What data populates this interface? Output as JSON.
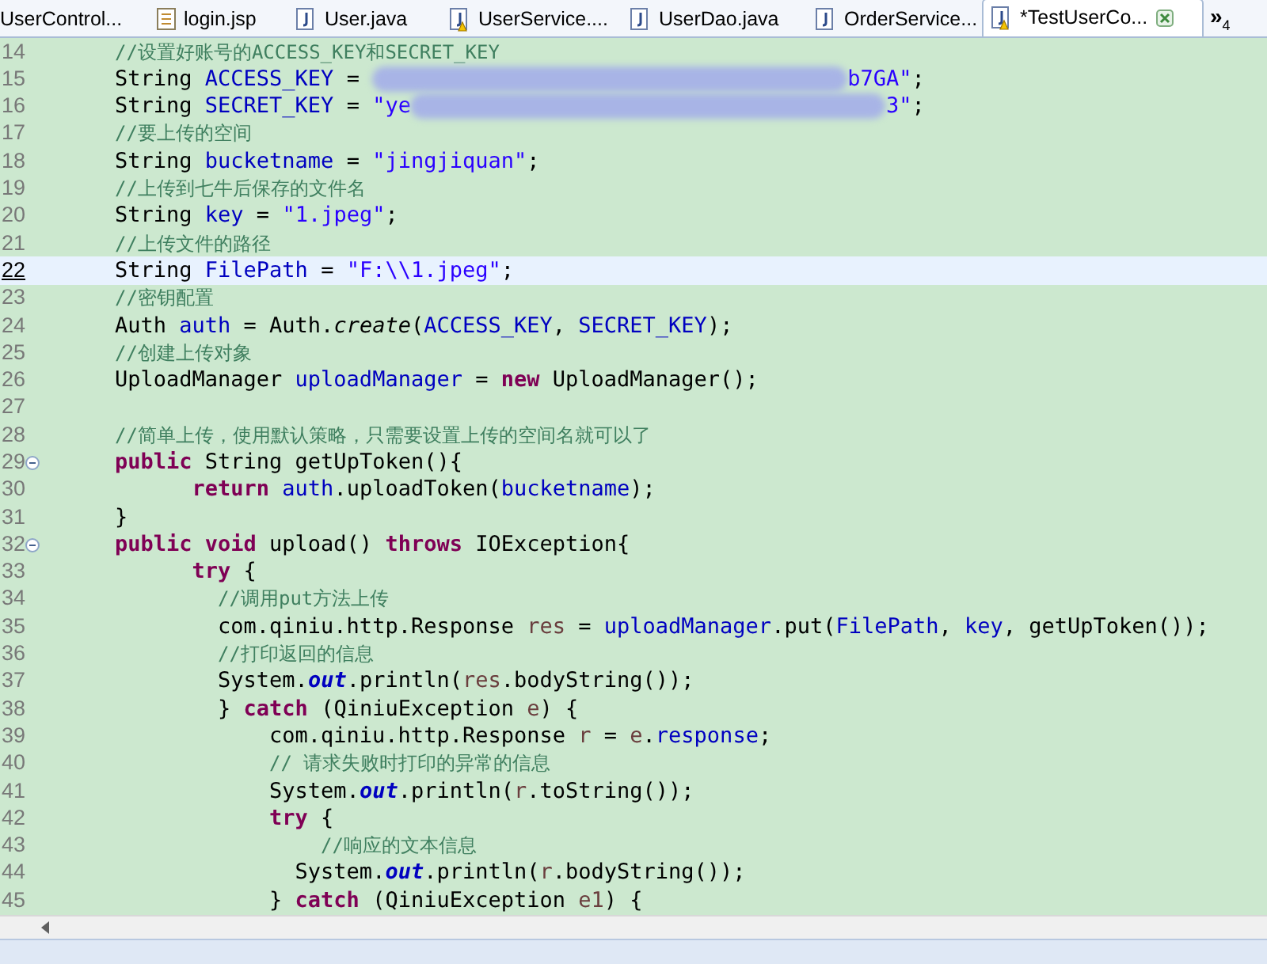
{
  "tabs": [
    {
      "label": "UserControl...",
      "kind": "plain",
      "selected": false
    },
    {
      "label": "login.jsp",
      "kind": "page",
      "selected": false
    },
    {
      "label": "User.java",
      "kind": "java",
      "selected": false
    },
    {
      "label": "UserService....",
      "kind": "java_warning",
      "selected": false
    },
    {
      "label": "UserDao.java",
      "kind": "java",
      "selected": false
    },
    {
      "label": "OrderService...",
      "kind": "java",
      "selected": false
    },
    {
      "label": "*TestUserCo...",
      "kind": "java_warning",
      "selected": true
    }
  ],
  "overflow": {
    "symbol": "»",
    "count": "4"
  },
  "editor": {
    "lines": [
      {
        "number": "14",
        "current": false,
        "fold": false,
        "tokens": [
          {
            "kind": "comment",
            "text": "//设置好账号的ACCESS_KEY和SECRET_KEY"
          }
        ]
      },
      {
        "number": "15",
        "current": false,
        "fold": false,
        "tokens": [
          {
            "kind": "plain",
            "text": "String "
          },
          {
            "kind": "field",
            "text": "ACCESS_KEY"
          },
          {
            "kind": "plain",
            "text": " = "
          },
          {
            "kind": "redacted"
          },
          {
            "kind": "string",
            "text": "b7GA\""
          },
          {
            "kind": "plain",
            "text": ";"
          }
        ]
      },
      {
        "number": "16",
        "current": false,
        "fold": false,
        "tokens": [
          {
            "kind": "plain",
            "text": "String "
          },
          {
            "kind": "field",
            "text": "SECRET_KEY"
          },
          {
            "kind": "plain",
            "text": " = "
          },
          {
            "kind": "string",
            "text": "\"ye"
          },
          {
            "kind": "redacted"
          },
          {
            "kind": "string",
            "text": "3\""
          },
          {
            "kind": "plain",
            "text": ";"
          }
        ]
      },
      {
        "number": "17",
        "current": false,
        "fold": false,
        "tokens": [
          {
            "kind": "comment",
            "text": "//要上传的空间"
          }
        ]
      },
      {
        "number": "18",
        "current": false,
        "fold": false,
        "tokens": [
          {
            "kind": "plain",
            "text": "String "
          },
          {
            "kind": "field",
            "text": "bucketname"
          },
          {
            "kind": "plain",
            "text": " = "
          },
          {
            "kind": "string",
            "text": "\"jingjiquan\""
          },
          {
            "kind": "plain",
            "text": ";"
          }
        ]
      },
      {
        "number": "19",
        "current": false,
        "fold": false,
        "tokens": [
          {
            "kind": "comment",
            "text": "//上传到七牛后保存的文件名"
          }
        ]
      },
      {
        "number": "20",
        "current": false,
        "fold": false,
        "tokens": [
          {
            "kind": "plain",
            "text": "String "
          },
          {
            "kind": "field",
            "text": "key"
          },
          {
            "kind": "plain",
            "text": " = "
          },
          {
            "kind": "string",
            "text": "\"1.jpeg\""
          },
          {
            "kind": "plain",
            "text": ";"
          }
        ]
      },
      {
        "number": "21",
        "current": false,
        "fold": false,
        "tokens": [
          {
            "kind": "comment",
            "text": "//上传文件的路径"
          }
        ]
      },
      {
        "number": "22",
        "current": true,
        "fold": false,
        "tokens": [
          {
            "kind": "plain",
            "text": "String "
          },
          {
            "kind": "field",
            "text": "FilePath"
          },
          {
            "kind": "plain",
            "text": " = "
          },
          {
            "kind": "string",
            "text": "\"F:\\\\1.jpeg\""
          },
          {
            "kind": "plain",
            "text": ";"
          }
        ]
      },
      {
        "number": "23",
        "current": false,
        "fold": false,
        "tokens": [
          {
            "kind": "comment",
            "text": "//密钥配置"
          }
        ]
      },
      {
        "number": "24",
        "current": false,
        "fold": false,
        "tokens": [
          {
            "kind": "plain",
            "text": "Auth "
          },
          {
            "kind": "field",
            "text": "auth"
          },
          {
            "kind": "plain",
            "text": " = Auth."
          },
          {
            "kind": "italic",
            "text": "create"
          },
          {
            "kind": "plain",
            "text": "("
          },
          {
            "kind": "field",
            "text": "ACCESS_KEY"
          },
          {
            "kind": "plain",
            "text": ", "
          },
          {
            "kind": "field",
            "text": "SECRET_KEY"
          },
          {
            "kind": "plain",
            "text": ");"
          }
        ]
      },
      {
        "number": "25",
        "current": false,
        "fold": false,
        "tokens": [
          {
            "kind": "comment",
            "text": "//创建上传对象"
          }
        ]
      },
      {
        "number": "26",
        "current": false,
        "fold": false,
        "tokens": [
          {
            "kind": "plain",
            "text": "UploadManager "
          },
          {
            "kind": "field",
            "text": "uploadManager"
          },
          {
            "kind": "plain",
            "text": " = "
          },
          {
            "kind": "keyword",
            "text": "new"
          },
          {
            "kind": "plain",
            "text": " UploadManager();"
          }
        ]
      },
      {
        "number": "27",
        "current": false,
        "fold": false
      },
      {
        "number": "28",
        "current": false,
        "fold": false,
        "tokens": [
          {
            "kind": "comment",
            "text": "//简单上传，使用默认策略，只需要设置上传的空间名就可以了"
          }
        ]
      },
      {
        "number": "29",
        "current": false,
        "fold": true,
        "tokens": [
          {
            "kind": "keyword",
            "text": "public"
          },
          {
            "kind": "plain",
            "text": " String getUpToken(){"
          }
        ]
      },
      {
        "number": "30",
        "current": false,
        "fold": false,
        "tokens": [
          {
            "kind": "keyword",
            "text": "return "
          },
          {
            "kind": "field",
            "text": "auth"
          },
          {
            "kind": "plain",
            "text": ".uploadToken("
          },
          {
            "kind": "field",
            "text": "bucketname"
          },
          {
            "kind": "plain",
            "text": ");"
          }
        ]
      },
      {
        "number": "31",
        "current": false,
        "fold": false,
        "tokens": [
          {
            "kind": "plain",
            "text": "}"
          }
        ]
      },
      {
        "number": "32",
        "current": false,
        "fold": true,
        "tokens": [
          {
            "kind": "keyword",
            "text": "public void"
          },
          {
            "kind": "plain",
            "text": " upload() "
          },
          {
            "kind": "keyword",
            "text": "throws"
          },
          {
            "kind": "plain",
            "text": " IOException{"
          }
        ]
      },
      {
        "number": "33",
        "current": false,
        "fold": false,
        "tokens": [
          {
            "kind": "keyword",
            "text": "try"
          },
          {
            "kind": "plain",
            "text": " {"
          }
        ]
      },
      {
        "number": "34",
        "current": false,
        "fold": false,
        "tokens": [
          {
            "kind": "comment",
            "text": "//调用put方法上传"
          }
        ]
      },
      {
        "number": "35",
        "current": false,
        "fold": false,
        "tokens": [
          {
            "kind": "plain",
            "text": "com.qiniu.http.Response "
          },
          {
            "kind": "local",
            "text": "res"
          },
          {
            "kind": "plain",
            "text": " = "
          },
          {
            "kind": "field",
            "text": "uploadManager"
          },
          {
            "kind": "plain",
            "text": ".put("
          },
          {
            "kind": "field",
            "text": "FilePath"
          },
          {
            "kind": "plain",
            "text": ", "
          },
          {
            "kind": "field",
            "text": "key"
          },
          {
            "kind": "plain",
            "text": ", getUpToken());"
          }
        ]
      },
      {
        "number": "36",
        "current": false,
        "fold": false,
        "tokens": [
          {
            "kind": "comment",
            "text": "//打印返回的信息"
          }
        ]
      },
      {
        "number": "37",
        "current": false,
        "fold": false,
        "tokens": [
          {
            "kind": "plain",
            "text": "System."
          },
          {
            "kind": "static",
            "text": "out"
          },
          {
            "kind": "plain",
            "text": ".println("
          },
          {
            "kind": "local",
            "text": "res"
          },
          {
            "kind": "plain",
            "text": ".bodyString());"
          }
        ]
      },
      {
        "number": "38",
        "current": false,
        "fold": false,
        "tokens": [
          {
            "kind": "plain",
            "text": "} "
          },
          {
            "kind": "keyword",
            "text": "catch"
          },
          {
            "kind": "plain",
            "text": " (QiniuException "
          },
          {
            "kind": "local",
            "text": "e"
          },
          {
            "kind": "plain",
            "text": ") {"
          }
        ]
      },
      {
        "number": "39",
        "current": false,
        "fold": false,
        "tokens": [
          {
            "kind": "plain",
            "text": "com.qiniu.http.Response "
          },
          {
            "kind": "local",
            "text": "r"
          },
          {
            "kind": "plain",
            "text": " = "
          },
          {
            "kind": "local",
            "text": "e"
          },
          {
            "kind": "plain",
            "text": "."
          },
          {
            "kind": "field",
            "text": "response"
          },
          {
            "kind": "plain",
            "text": ";"
          }
        ]
      },
      {
        "number": "40",
        "current": false,
        "fold": false,
        "tokens": [
          {
            "kind": "comment",
            "text": "// 请求失败时打印的异常的信息"
          }
        ]
      },
      {
        "number": "41",
        "current": false,
        "fold": false,
        "tokens": [
          {
            "kind": "plain",
            "text": "System."
          },
          {
            "kind": "static",
            "text": "out"
          },
          {
            "kind": "plain",
            "text": ".println("
          },
          {
            "kind": "local",
            "text": "r"
          },
          {
            "kind": "plain",
            "text": ".toString());"
          }
        ]
      },
      {
        "number": "42",
        "current": false,
        "fold": false,
        "tokens": [
          {
            "kind": "keyword",
            "text": "try"
          },
          {
            "kind": "plain",
            "text": " {"
          }
        ]
      },
      {
        "number": "43",
        "current": false,
        "fold": false,
        "tokens": [
          {
            "kind": "comment",
            "text": "//响应的文本信息"
          }
        ]
      },
      {
        "number": "44",
        "current": false,
        "fold": false,
        "tokens": [
          {
            "kind": "plain",
            "text": "System."
          },
          {
            "kind": "static",
            "text": "out"
          },
          {
            "kind": "plain",
            "text": ".println("
          },
          {
            "kind": "local",
            "text": "r"
          },
          {
            "kind": "plain",
            "text": ".bodyString());"
          }
        ]
      },
      {
        "number": "45",
        "current": false,
        "fold": false,
        "tokens": [
          {
            "kind": "plain",
            "text": "} "
          },
          {
            "kind": "keyword",
            "text": "catch"
          },
          {
            "kind": "plain",
            "text": " (QiniuException "
          },
          {
            "kind": "local",
            "text": "e1"
          },
          {
            "kind": "plain",
            "text": ") {"
          }
        ]
      }
    ]
  }
}
